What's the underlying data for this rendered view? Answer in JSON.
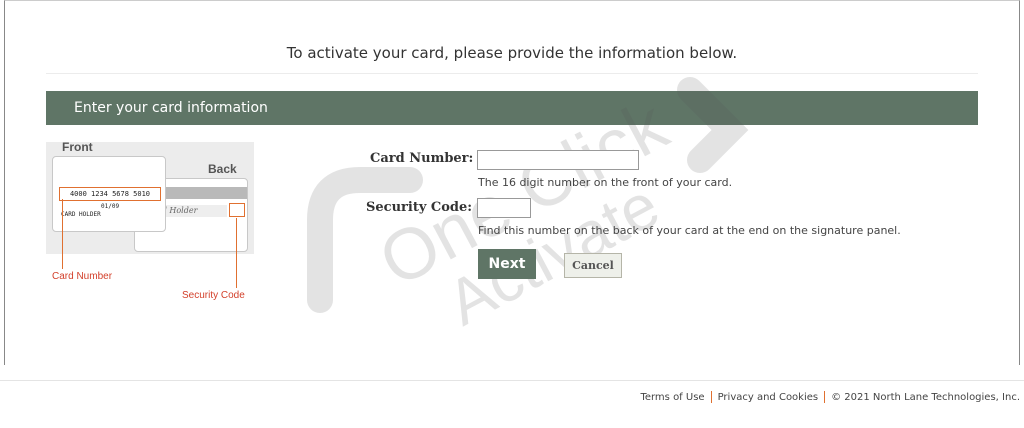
{
  "intro": "To activate your card, please provide the information below.",
  "section_title": "Enter your card information",
  "watermark": {
    "line1": "One Click",
    "line2": "Activate"
  },
  "illustration": {
    "front_label": "Front",
    "back_label": "Back",
    "card_number_sample": "4000 1234 5678 5010",
    "expiry_sample": "01/09",
    "holder_sample": "CARD HOLDER",
    "signature_sample": "Card Holder",
    "card_number_caption": "Card Number",
    "security_code_caption": "Security Code"
  },
  "form": {
    "card_number_label": "Card Number:",
    "card_number_value": "",
    "card_number_help": "The 16 digit number on the front of your card.",
    "security_code_label": "Security Code:",
    "security_code_value": "",
    "security_code_help": "Find this number on the back of your card at the end on the signature panel.",
    "next_label": "Next",
    "cancel_label": "Cancel"
  },
  "footer": {
    "terms": "Terms of Use",
    "privacy": "Privacy and Cookies",
    "copyright": "© 2021 North Lane Technologies, Inc."
  },
  "colors": {
    "accent": "#5f7566",
    "highlight": "#e07030",
    "caption": "#d3402b"
  }
}
